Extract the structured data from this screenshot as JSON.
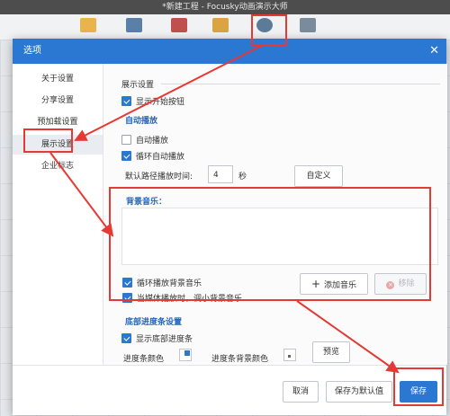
{
  "app": {
    "title": "*新建工程 - Focusky动画演示大师"
  },
  "dialog": {
    "title": "选项",
    "close_symbol": "✕"
  },
  "sidebar": {
    "items": [
      {
        "label": "关于设置"
      },
      {
        "label": "分享设置"
      },
      {
        "label": "预加载设置"
      },
      {
        "label": "展示设置"
      },
      {
        "label": "企业标志"
      }
    ]
  },
  "content": {
    "section_title": "展示设置",
    "show_start_button": "显示开始按钮",
    "autoplay_group": "自动播放",
    "autoplay": "自动播放",
    "loop_autoplay": "循环自动播放",
    "path_time_label": "默认路径播放时间:",
    "path_time_value": "4",
    "path_time_unit": "秒",
    "custom_button": "自定义",
    "bgm_group": "背景音乐：",
    "loop_bgm": "循环播放背景音乐",
    "lower_bgm": "当媒体播放时，调小背景音乐",
    "add_music_button": "添加音乐",
    "remove_button": "移除",
    "progress_group": "底部进度条设置",
    "show_progress_bar": "显示底部进度条",
    "progress_color_label": "进度条颜色",
    "progress_bg_color_label": "进度条背景颜色",
    "preview_button": "预览"
  },
  "checkbox_states": {
    "show_start_button": true,
    "autoplay": false,
    "loop_autoplay": true,
    "loop_bgm": true,
    "lower_bgm": true,
    "show_progress_bar": true
  },
  "footer": {
    "cancel": "取消",
    "save_default": "保存为默认值",
    "save": "保存"
  },
  "colors": {
    "accent": "#2b78d2",
    "annotation": "#e53935",
    "progress_color": "#2b78d2",
    "progress_bg_color": "#9aa1aa"
  }
}
